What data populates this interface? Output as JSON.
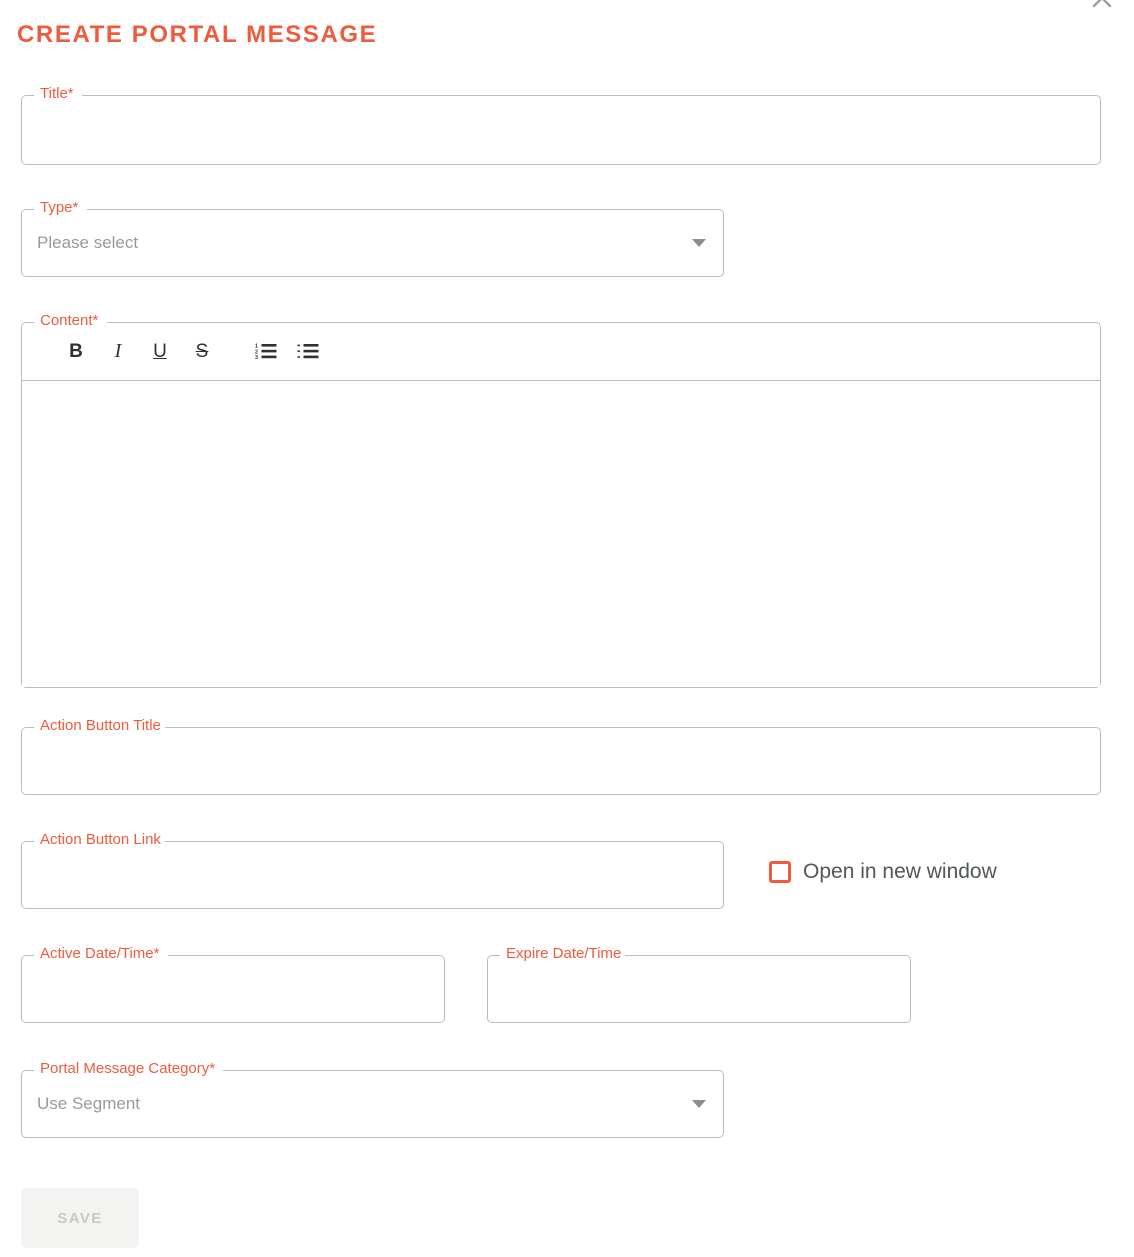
{
  "header": {
    "title": "CREATE PORTAL MESSAGE",
    "close_icon": "close-icon"
  },
  "theme": {
    "accent": "#ee5b3d",
    "border": "#b6bfbf",
    "placeholder_text": "#9a9a9a",
    "disabled_button_bg": "#f3f3f2",
    "disabled_button_text": "#c8c8c6"
  },
  "form": {
    "title_field": {
      "label": "Title",
      "required_mark": "*",
      "value": "",
      "placeholder": ""
    },
    "type_field": {
      "label": "Type",
      "required_mark": "*",
      "value": "Please select"
    },
    "content_field": {
      "label": "Content",
      "required_mark": "*",
      "value": "",
      "toolbar": [
        {
          "name": "bold-icon",
          "glyph": "B",
          "title": "Bold"
        },
        {
          "name": "italic-icon",
          "glyph": "I",
          "title": "Italic"
        },
        {
          "name": "underline-icon",
          "glyph": "U",
          "title": "Underline"
        },
        {
          "name": "strikethrough-icon",
          "glyph": "S",
          "title": "Strikethrough"
        },
        {
          "name": "ordered-list-icon",
          "glyph": "",
          "title": "Ordered list"
        },
        {
          "name": "unordered-list-icon",
          "glyph": "",
          "title": "Unordered list"
        }
      ]
    },
    "action_button_title_field": {
      "label": "Action Button Title",
      "required_mark": "",
      "value": ""
    },
    "action_button_link_field": {
      "label": "Action Button Link",
      "required_mark": "",
      "value": ""
    },
    "open_new_window": {
      "label": "Open in new window",
      "checked": false
    },
    "active_date_field": {
      "label": "Active Date/Time",
      "required_mark": "*",
      "value": ""
    },
    "expire_date_field": {
      "label": "Expire Date/Time",
      "required_mark": "",
      "value": ""
    },
    "category_field": {
      "label": "Portal Message Category",
      "required_mark": "*",
      "value": "Use Segment"
    },
    "save_button": {
      "label": "SAVE",
      "enabled": false
    }
  }
}
